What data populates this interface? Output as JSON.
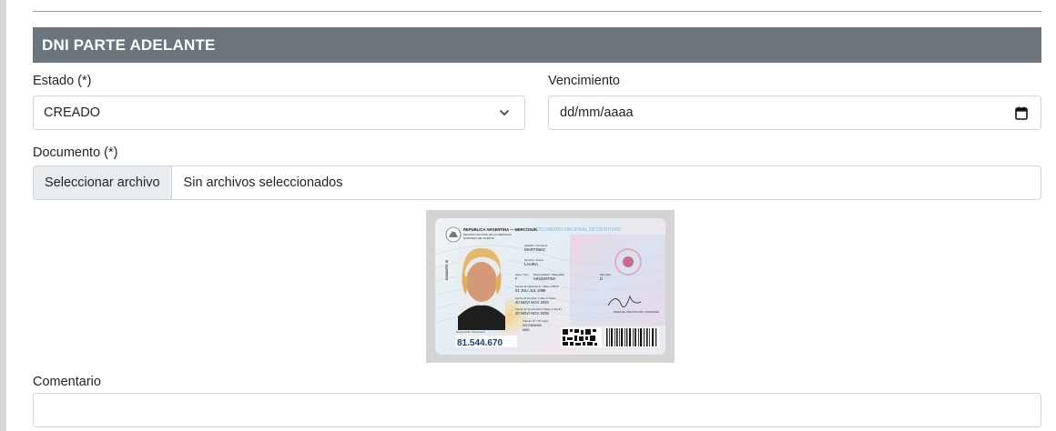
{
  "section": {
    "title": "DNI PARTE ADELANTE"
  },
  "estado": {
    "label": "Estado (*)",
    "value": "CREADO"
  },
  "vencimiento": {
    "label": "Vencimiento",
    "placeholder": "dd/mm/aaaa"
  },
  "documento": {
    "label": "Documento (*)",
    "button_label": "Seleccionar archivo",
    "file_status": "Sin archivos seleccionados"
  },
  "preview": {
    "header_left": "REPUBLICA ARGENTINA — MERCOSUR",
    "header_sub1": "REGISTRO NACIONAL DE LAS PERSONAS",
    "header_sub2": "MINISTERIO DEL INTERIOR",
    "header_right": "DOCUMENTO NACIONAL DE IDENTIDAD",
    "side_label": "DONANTE: SI",
    "apellido_label": "Apellido / Surname",
    "apellido": "MARTINEZ",
    "nombre_label": "Nombre / Name",
    "nombre": "LAURA",
    "sexo_label": "Sexo / Sex",
    "sexo": "F",
    "nacionalidad_label": "Nacionalidad / Nationality",
    "nacionalidad": "ARGENTINA",
    "ejemplar_label": "Ejemplar",
    "ejemplar": "D",
    "nacimiento_label": "Fecha de Nacimiento / Date of Birth",
    "nacimiento": "01 JUL/ JUL 1999",
    "emision_label": "Fecha de Emisión / Date of issue",
    "emision": "20 NOV/ NOV 2020",
    "vencimiento_label": "Fecha de Vencimiento / Date of Expiry",
    "vencimiento": "20 NOV/ NOV 2035",
    "firma_label": "FIRMA DEL IDENTIFICADO / SIGNATURE",
    "documento_label": "Documento / Document",
    "tramite_label": "Trámite Nº / Of. ident.",
    "tramite": "00170696969",
    "tramite2": "6050",
    "documento_number": "81.544.670"
  },
  "comentario": {
    "label": "Comentario",
    "value": ""
  },
  "colors": {
    "header_bg": "#6c747c",
    "border": "#ced4da",
    "file_button_bg": "#e9ecef"
  }
}
